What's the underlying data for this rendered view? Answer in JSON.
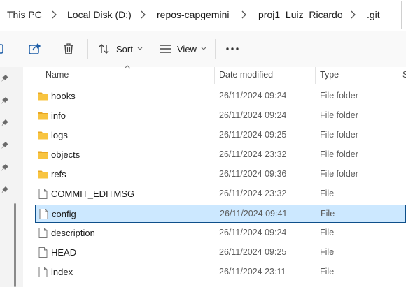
{
  "breadcrumb": {
    "items": [
      "This PC",
      "Local Disk (D:)",
      "repos-capgemini",
      "proj1_Luiz_Ricardo",
      ".git"
    ]
  },
  "toolbar": {
    "buttons": [
      {
        "icon": "share-icon"
      },
      {
        "icon": "delete-icon"
      },
      {
        "icon": "sort-icon",
        "label": "Sort"
      },
      {
        "icon": "view-icon",
        "label": "View"
      },
      {
        "icon": "more-options-icon"
      }
    ]
  },
  "columns": {
    "name": "Name",
    "date": "Date modified",
    "type": "Type",
    "size": "S"
  },
  "files": [
    {
      "name": "hooks",
      "date": "26/11/2024 09:24",
      "type": "File folder",
      "kind": "folder"
    },
    {
      "name": "info",
      "date": "26/11/2024 09:24",
      "type": "File folder",
      "kind": "folder"
    },
    {
      "name": "logs",
      "date": "26/11/2024 09:25",
      "type": "File folder",
      "kind": "folder"
    },
    {
      "name": "objects",
      "date": "26/11/2024 23:32",
      "type": "File folder",
      "kind": "folder"
    },
    {
      "name": "refs",
      "date": "26/11/2024 09:36",
      "type": "File folder",
      "kind": "folder"
    },
    {
      "name": "COMMIT_EDITMSG",
      "date": "26/11/2024 23:32",
      "type": "File",
      "kind": "file"
    },
    {
      "name": "config",
      "date": "26/11/2024 09:41",
      "type": "File",
      "kind": "file",
      "selected": true
    },
    {
      "name": "description",
      "date": "26/11/2024 09:24",
      "type": "File",
      "kind": "file"
    },
    {
      "name": "HEAD",
      "date": "26/11/2024 09:25",
      "type": "File",
      "kind": "file"
    },
    {
      "name": "index",
      "date": "26/11/2024 23:11",
      "type": "File",
      "kind": "file"
    }
  ],
  "colors": {
    "selection_bg": "#cce8ff",
    "selection_border": "#0e4f8a",
    "folder": "#f8c440"
  }
}
